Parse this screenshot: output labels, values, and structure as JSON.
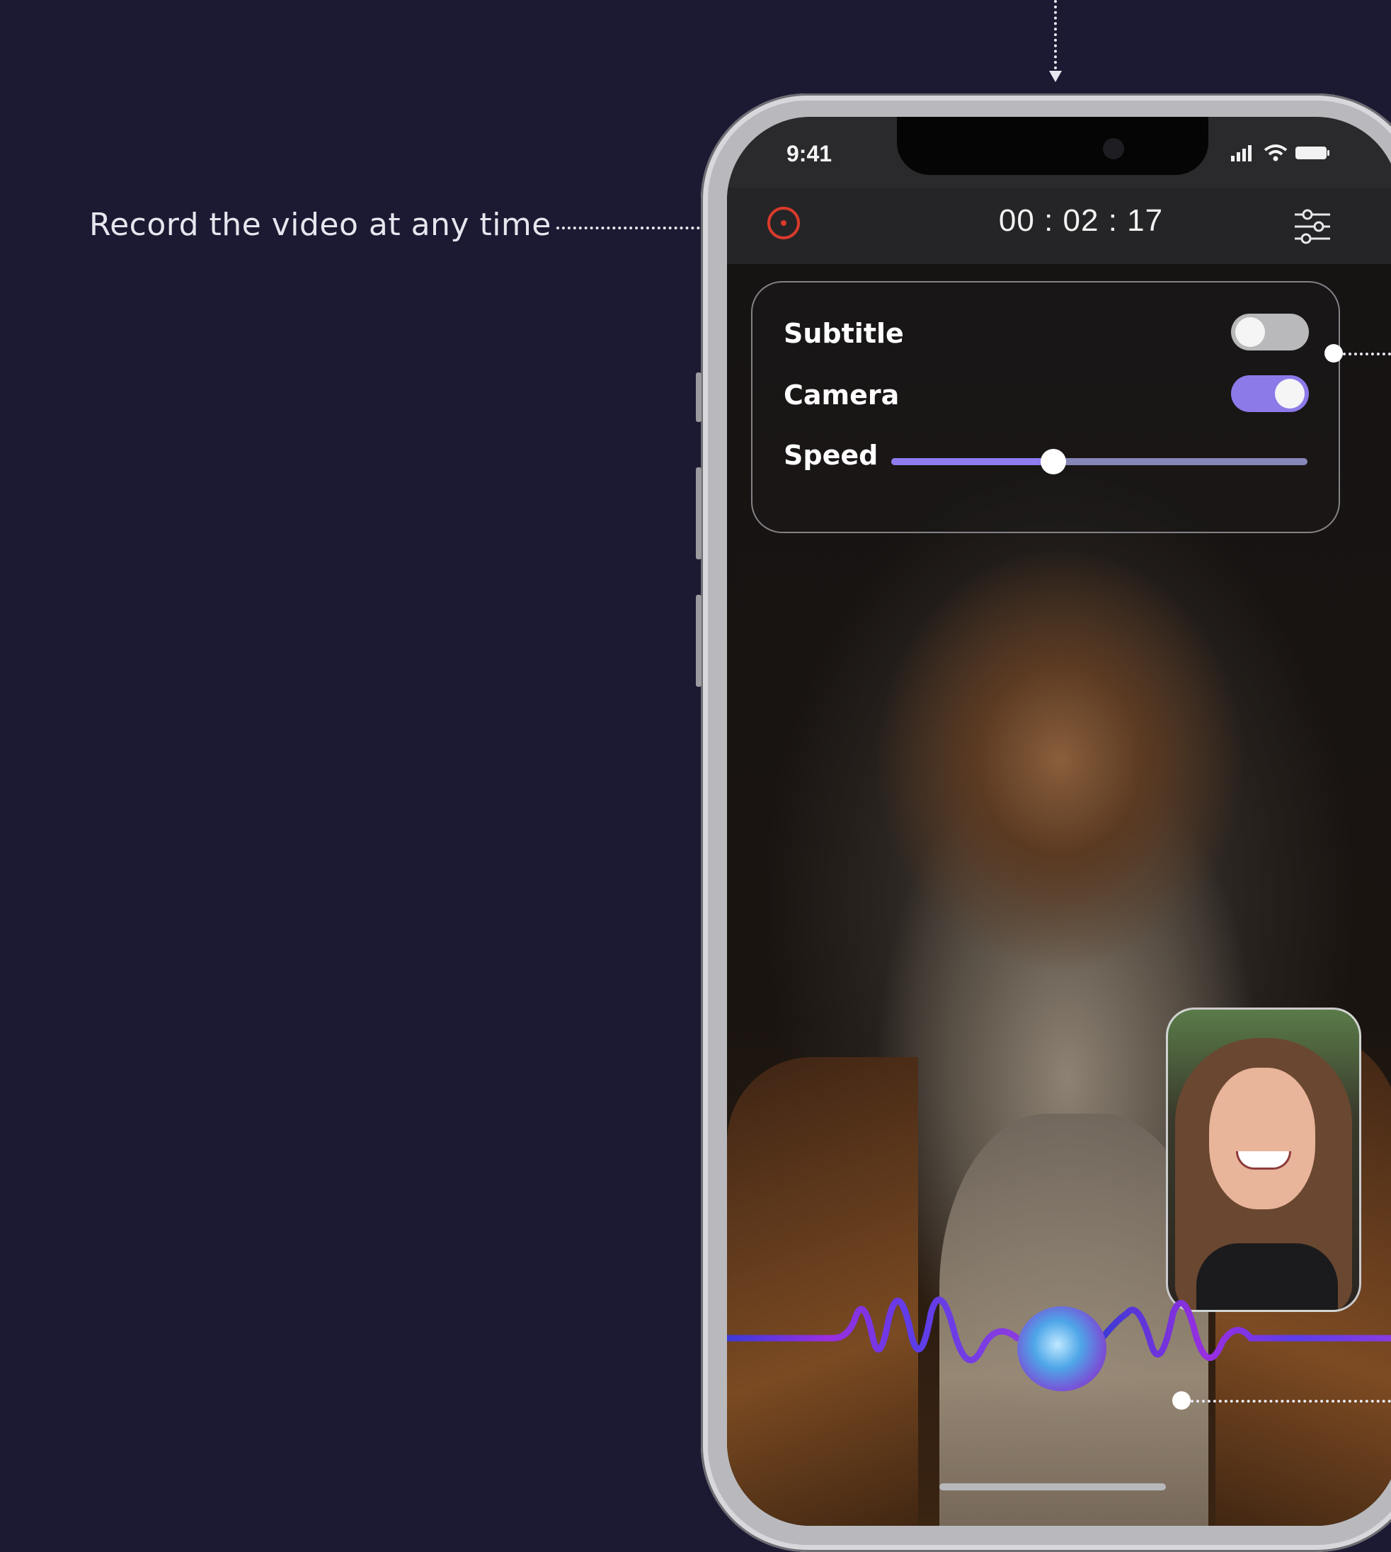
{
  "annotation": {
    "record_text": "Record the video at any time"
  },
  "status_bar": {
    "time": "9:41",
    "icons": [
      "signal-icon",
      "wifi-icon",
      "battery-icon"
    ]
  },
  "top_bar": {
    "timer": "00 : 02 : 17",
    "record_icon": "record-icon",
    "settings_icon": "sliders-icon"
  },
  "settings_panel": {
    "subtitle_label": "Subtitle",
    "subtitle_on": false,
    "camera_label": "Camera",
    "camera_on": true,
    "speed_label": "Speed",
    "speed_value": 0.39
  },
  "colors": {
    "background": "#1c1a33",
    "accent": "#8e7cf0",
    "record": "#d93a2b",
    "wave": "#7a3ce0"
  }
}
